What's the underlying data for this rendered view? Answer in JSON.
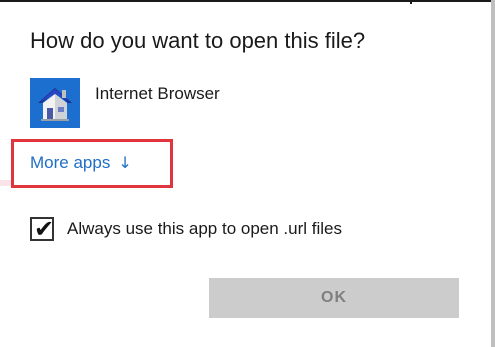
{
  "dialog": {
    "title": "How do you want to open this file?"
  },
  "app": {
    "name": "Internet Browser",
    "icon": "house-icon"
  },
  "more_apps": {
    "label": "More apps",
    "arrow": "↓",
    "highlight_color": "#e0353c",
    "link_color": "#1f6fc4"
  },
  "always_use": {
    "label": "Always use this app to open .url files",
    "checked": true
  },
  "ok_button": {
    "label": "OK",
    "enabled": false
  }
}
